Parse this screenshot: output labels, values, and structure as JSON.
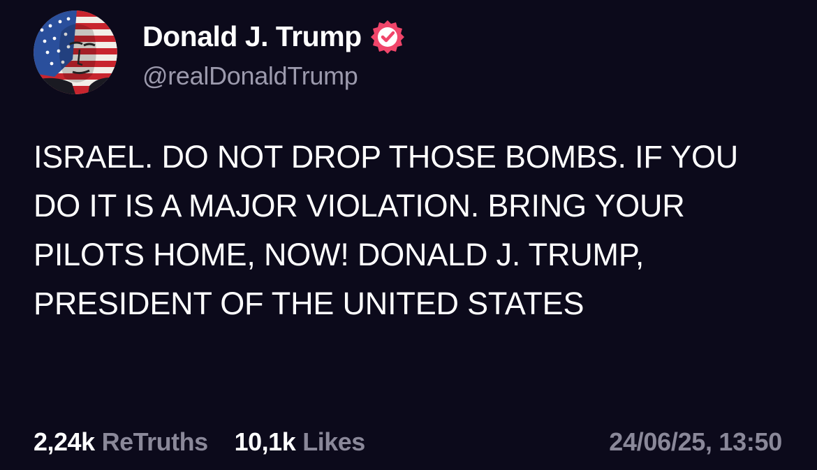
{
  "author": {
    "display_name": "Donald J. Trump",
    "handle": "@realDonaldTrump",
    "verified_icon": "verified-badge-icon",
    "avatar": "profile-avatar-american-flag-face"
  },
  "post": {
    "text": "ISRAEL. DO NOT DROP THOSE BOMBS. IF YOU DO IT IS A MAJOR VIOLATION. BRING YOUR PILOTS HOME, NOW! DONALD J. TRUMP, PRESIDENT OF THE UNITED STATES"
  },
  "stats": {
    "retruths_count": "2,24k",
    "retruths_label": "ReTruths",
    "likes_count": "10,1k",
    "likes_label": "Likes"
  },
  "timestamp": "24/06/25, 13:50",
  "colors": {
    "background": "#0c0a1b",
    "text": "#ffffff",
    "muted": "#8a8899",
    "verified_badge": "#f0456a"
  }
}
